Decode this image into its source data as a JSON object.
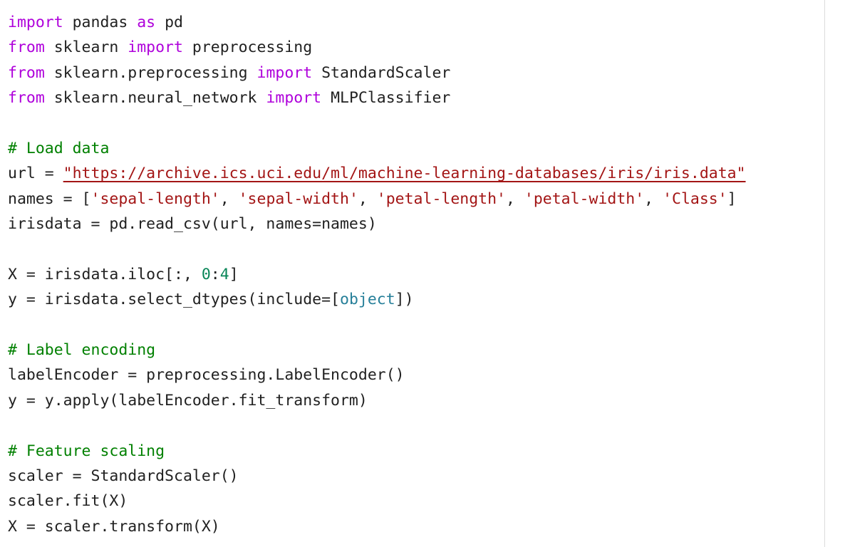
{
  "editor": {
    "lines": [
      [
        {
          "t": "import",
          "c": "kw"
        },
        {
          "t": " pandas ",
          "c": ""
        },
        {
          "t": "as",
          "c": "kw"
        },
        {
          "t": " pd",
          "c": ""
        }
      ],
      [
        {
          "t": "from",
          "c": "kw"
        },
        {
          "t": " sklearn ",
          "c": ""
        },
        {
          "t": "import",
          "c": "kw"
        },
        {
          "t": " preprocessing",
          "c": ""
        }
      ],
      [
        {
          "t": "from",
          "c": "kw"
        },
        {
          "t": " sklearn.preprocessing ",
          "c": ""
        },
        {
          "t": "import",
          "c": "kw"
        },
        {
          "t": " StandardScaler",
          "c": ""
        }
      ],
      [
        {
          "t": "from",
          "c": "kw"
        },
        {
          "t": " sklearn.neural_network ",
          "c": ""
        },
        {
          "t": "import",
          "c": "kw"
        },
        {
          "t": " MLPClassifier",
          "c": ""
        }
      ],
      [],
      [
        {
          "t": "# Load data",
          "c": "cm"
        }
      ],
      [
        {
          "t": "url = ",
          "c": ""
        },
        {
          "t": "\"https://archive.ics.uci.edu/ml/machine-learning-databases/iris/iris.data\"",
          "c": "url-str"
        }
      ],
      [
        {
          "t": "names = [",
          "c": ""
        },
        {
          "t": "'sepal-length'",
          "c": "str"
        },
        {
          "t": ", ",
          "c": ""
        },
        {
          "t": "'sepal-width'",
          "c": "str"
        },
        {
          "t": ", ",
          "c": ""
        },
        {
          "t": "'petal-length'",
          "c": "str"
        },
        {
          "t": ", ",
          "c": ""
        },
        {
          "t": "'petal-width'",
          "c": "str"
        },
        {
          "t": ", ",
          "c": ""
        },
        {
          "t": "'Class'",
          "c": "str"
        },
        {
          "t": "]",
          "c": ""
        }
      ],
      [
        {
          "t": "irisdata = pd.read_csv(url, names=names)",
          "c": ""
        }
      ],
      [],
      [
        {
          "t": "X = irisdata.iloc[:, ",
          "c": ""
        },
        {
          "t": "0",
          "c": "num"
        },
        {
          "t": ":",
          "c": ""
        },
        {
          "t": "4",
          "c": "num"
        },
        {
          "t": "]",
          "c": ""
        }
      ],
      [
        {
          "t": "y = irisdata.select_dtypes(include=[",
          "c": ""
        },
        {
          "t": "object",
          "c": "bi"
        },
        {
          "t": "])",
          "c": ""
        }
      ],
      [],
      [
        {
          "t": "# Label encoding",
          "c": "cm"
        }
      ],
      [
        {
          "t": "labelEncoder = preprocessing.LabelEncoder()",
          "c": ""
        }
      ],
      [
        {
          "t": "y = y.apply(labelEncoder.fit_transform)",
          "c": ""
        }
      ],
      [],
      [
        {
          "t": "# Feature scaling",
          "c": "cm"
        }
      ],
      [
        {
          "t": "scaler = StandardScaler()",
          "c": ""
        }
      ],
      [
        {
          "t": "scaler.fit(X)",
          "c": ""
        }
      ],
      [
        {
          "t": "X = scaler.transform(X)",
          "c": ""
        }
      ]
    ]
  },
  "colors": {
    "keyword": "#af00db",
    "comment": "#008000",
    "string": "#a31515",
    "number": "#098658",
    "builtin": "#267f99",
    "text": "#212121"
  }
}
